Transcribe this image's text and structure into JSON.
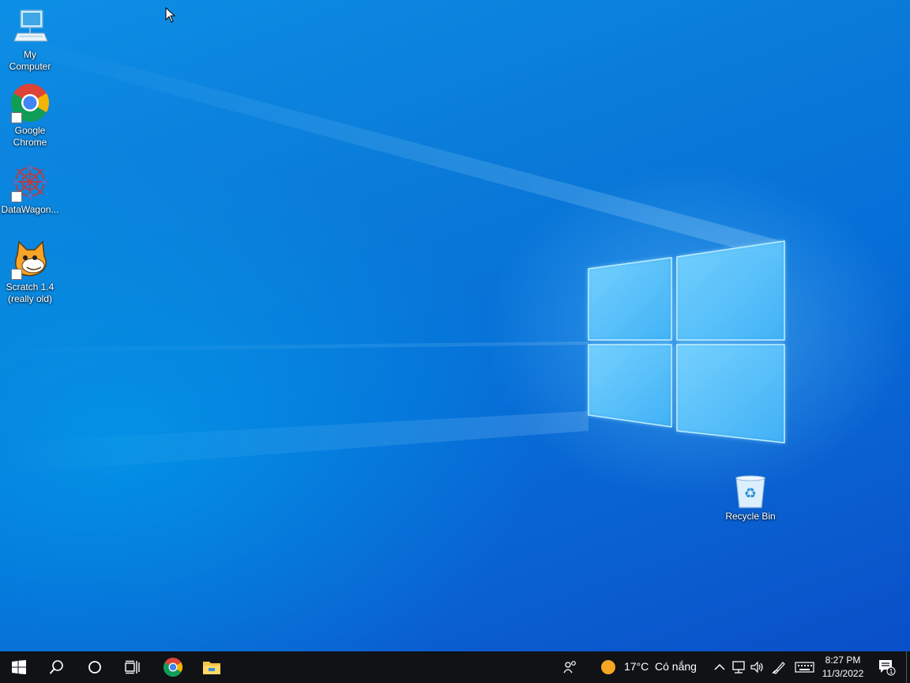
{
  "desktop_icons": [
    {
      "name": "my-computer",
      "label": "My\nComputer"
    },
    {
      "name": "google-chrome",
      "label": "Google\nChrome"
    },
    {
      "name": "datawagon",
      "label": "DataWagon..."
    },
    {
      "name": "scratch",
      "label": "Scratch 1.4\n(really old)"
    },
    {
      "name": "recycle-bin",
      "label": "Recycle Bin"
    }
  ],
  "taskbar": {
    "start_icon": "windows-logo-icon",
    "search_icon": "search-icon",
    "cortana_icon": "cortana-circle-icon",
    "task_view_icon": "task-view-icon",
    "pinned": [
      "google-chrome-icon",
      "file-explorer-icon"
    ],
    "weather": {
      "temp": "17°C",
      "condition": "Có nắng"
    },
    "tray_icons": [
      "people-icon",
      "chevron-up-icon",
      "network-icon",
      "volume-icon",
      "pen-icon",
      "keyboard-icon"
    ],
    "clock": {
      "time": "8:27 PM",
      "date": "11/3/2022"
    },
    "notifications": {
      "count": "1"
    }
  },
  "colors": {
    "taskbar": "#101216",
    "wallpaper_accent": "#0078d7",
    "weather_sun": "#f5a623"
  }
}
